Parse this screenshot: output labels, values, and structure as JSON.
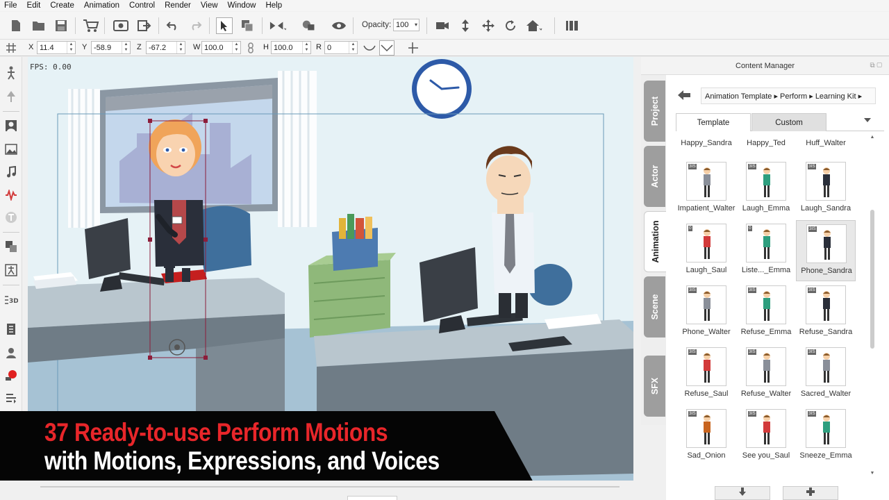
{
  "menu": [
    "File",
    "Edit",
    "Create",
    "Animation",
    "Control",
    "Render",
    "View",
    "Window",
    "Help"
  ],
  "toolbar": {
    "opacity_label": "Opacity:",
    "opacity_value": "100"
  },
  "transform": {
    "x_label": "X",
    "x_value": "11.4",
    "y_label": "Y",
    "y_value": "-58.9",
    "z_label": "Z",
    "z_value": "-67.2",
    "w_label": "W",
    "w_value": "100.0",
    "h_label": "H",
    "h_value": "100.0",
    "r_label": "R",
    "r_value": "0"
  },
  "stage": {
    "fps": "FPS: 0.00"
  },
  "panel": {
    "title": "Content Manager",
    "side_tabs": [
      "Project",
      "Actor",
      "Animation",
      "Scene",
      "SFX"
    ],
    "active_side_tab": "Animation",
    "breadcrumb": [
      "Animation Template",
      "Perform",
      "Learning Kit"
    ],
    "tabs": [
      "Template",
      "Custom"
    ],
    "active_tab": "Template",
    "top_row_labels": [
      "Happy_Sandra",
      "Happy_Ted",
      "Huff_Walter"
    ],
    "items": [
      {
        "name": "Impatient_Walter",
        "tag": "3IS",
        "color": "#8a8f99"
      },
      {
        "name": "Laugh_Emma",
        "tag": "3IS",
        "color": "#2e9e7e"
      },
      {
        "name": "Laugh_Sandra",
        "tag": "3IS",
        "color": "#2a2f3a"
      },
      {
        "name": "Laugh_Saul",
        "tag": "0",
        "color": "#d23a3a"
      },
      {
        "name": "Liste..._Emma",
        "tag": "0",
        "color": "#2e9e7e"
      },
      {
        "name": "Phone_Sandra",
        "tag": "3IS",
        "color": "#2a2f3a"
      },
      {
        "name": "Phone_Walter",
        "tag": "3IS",
        "color": "#8a8f99"
      },
      {
        "name": "Refuse_Emma",
        "tag": "3IS",
        "color": "#2e9e7e"
      },
      {
        "name": "Refuse_Sandra",
        "tag": "3IS",
        "color": "#2a2f3a"
      },
      {
        "name": "Refuse_Saul",
        "tag": "3IS",
        "color": "#d23a3a"
      },
      {
        "name": "Refuse_Walter",
        "tag": "3IS",
        "color": "#8a8f99"
      },
      {
        "name": "Sacred_Walter",
        "tag": "3IS",
        "color": "#8a8f99"
      },
      {
        "name": "Sad_Onion",
        "tag": "3IS",
        "color": "#c8641e"
      },
      {
        "name": "See you_Saul",
        "tag": "3IS",
        "color": "#d23a3a"
      },
      {
        "name": "Sneeze_Emma",
        "tag": "3IS",
        "color": "#2e9e7e"
      }
    ],
    "selected_item": "Phone_Sandra"
  },
  "caption": {
    "line1": "37 Ready-to-use Perform Motions",
    "line2": "with Motions, Expressions, and Voices"
  }
}
